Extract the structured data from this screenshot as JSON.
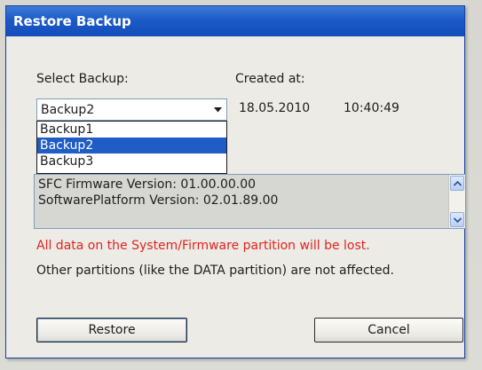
{
  "dialog": {
    "title": "Restore Backup",
    "select_label": "Select Backup:",
    "created_label": "Created at:",
    "selected_backup": "Backup2",
    "created_date": "18.05.2010",
    "created_time": "10:40:49",
    "backup_options": [
      "Backup1",
      "Backup2",
      "Backup3"
    ],
    "selected_index": 1,
    "info_lines": [
      "SFC Firmware Version: 01.00.00.00",
      "SoftwarePlatform Version: 02.01.89.00"
    ],
    "warning": "All data on the System/Firmware partition will be lost.",
    "note": "Other partitions (like the DATA partition) are not affected.",
    "restore_label": "Restore",
    "cancel_label": "Cancel"
  },
  "icons": {
    "combo_arrow": "chevron-down-icon",
    "scroll_up": "scroll-up-icon",
    "scroll_down": "scroll-down-icon"
  },
  "colors": {
    "titlebar": "#1b5bc7",
    "selection": "#1f5cc5",
    "warning": "#e0251f"
  }
}
